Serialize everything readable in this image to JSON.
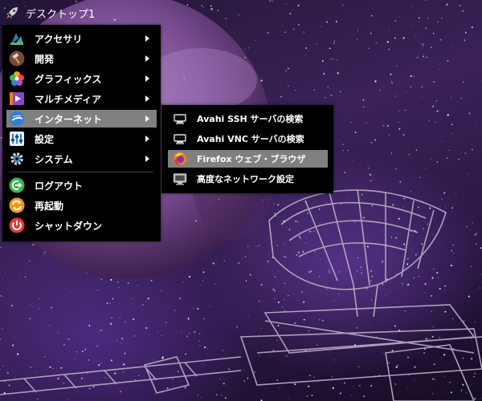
{
  "topbar": {
    "title": "デスクトップ1",
    "icon": "rocket-icon"
  },
  "main_menu": {
    "items": [
      {
        "label": "アクセサリ",
        "icon": "accessories-icon",
        "has_submenu": true
      },
      {
        "label": "開発",
        "icon": "development-icon",
        "has_submenu": true
      },
      {
        "label": "グラフィックス",
        "icon": "graphics-icon",
        "has_submenu": true
      },
      {
        "label": "マルチメディア",
        "icon": "multimedia-icon",
        "has_submenu": true
      },
      {
        "label": "インターネット",
        "icon": "internet-icon",
        "has_submenu": true,
        "highlighted": true
      },
      {
        "label": "設定",
        "icon": "settings-icon",
        "has_submenu": true
      },
      {
        "label": "システム",
        "icon": "system-icon",
        "has_submenu": true
      },
      {
        "label": "ログアウト",
        "icon": "logout-icon",
        "has_submenu": false
      },
      {
        "label": "再起動",
        "icon": "reboot-icon",
        "has_submenu": false
      },
      {
        "label": "シャットダウン",
        "icon": "shutdown-icon",
        "has_submenu": false
      }
    ]
  },
  "sub_menu": {
    "items": [
      {
        "label": "Avahi SSH サーバの検索",
        "icon": "network-icon"
      },
      {
        "label": "Avahi VNC サーバの検索",
        "icon": "network-icon"
      },
      {
        "label": "Firefox ウェブ・ブラウザ",
        "icon": "firefox-icon",
        "highlighted": true
      },
      {
        "label": "高度なネットワーク設定",
        "icon": "network-settings-icon"
      }
    ]
  },
  "colors": {
    "menu_bg": "#000000",
    "highlight": "#808080",
    "text": "#ffffff"
  }
}
